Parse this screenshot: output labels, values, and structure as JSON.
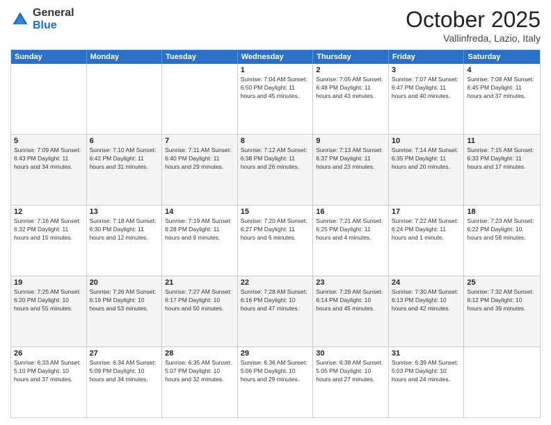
{
  "logo": {
    "general": "General",
    "blue": "Blue"
  },
  "header": {
    "month": "October 2025",
    "location": "Vallinfreda, Lazio, Italy"
  },
  "days": [
    "Sunday",
    "Monday",
    "Tuesday",
    "Wednesday",
    "Thursday",
    "Friday",
    "Saturday"
  ],
  "weeks": [
    [
      {
        "day": "",
        "info": ""
      },
      {
        "day": "",
        "info": ""
      },
      {
        "day": "",
        "info": ""
      },
      {
        "day": "1",
        "info": "Sunrise: 7:04 AM\nSunset: 6:50 PM\nDaylight: 11 hours and 45 minutes."
      },
      {
        "day": "2",
        "info": "Sunrise: 7:05 AM\nSunset: 6:48 PM\nDaylight: 11 hours and 43 minutes."
      },
      {
        "day": "3",
        "info": "Sunrise: 7:07 AM\nSunset: 6:47 PM\nDaylight: 11 hours and 40 minutes."
      },
      {
        "day": "4",
        "info": "Sunrise: 7:08 AM\nSunset: 6:45 PM\nDaylight: 11 hours and 37 minutes."
      }
    ],
    [
      {
        "day": "5",
        "info": "Sunrise: 7:09 AM\nSunset: 6:43 PM\nDaylight: 11 hours and 34 minutes."
      },
      {
        "day": "6",
        "info": "Sunrise: 7:10 AM\nSunset: 6:42 PM\nDaylight: 11 hours and 31 minutes."
      },
      {
        "day": "7",
        "info": "Sunrise: 7:11 AM\nSunset: 6:40 PM\nDaylight: 11 hours and 29 minutes."
      },
      {
        "day": "8",
        "info": "Sunrise: 7:12 AM\nSunset: 6:38 PM\nDaylight: 11 hours and 26 minutes."
      },
      {
        "day": "9",
        "info": "Sunrise: 7:13 AM\nSunset: 6:37 PM\nDaylight: 11 hours and 23 minutes."
      },
      {
        "day": "10",
        "info": "Sunrise: 7:14 AM\nSunset: 6:35 PM\nDaylight: 11 hours and 20 minutes."
      },
      {
        "day": "11",
        "info": "Sunrise: 7:15 AM\nSunset: 6:33 PM\nDaylight: 11 hours and 17 minutes."
      }
    ],
    [
      {
        "day": "12",
        "info": "Sunrise: 7:16 AM\nSunset: 6:32 PM\nDaylight: 11 hours and 15 minutes."
      },
      {
        "day": "13",
        "info": "Sunrise: 7:18 AM\nSunset: 6:30 PM\nDaylight: 11 hours and 12 minutes."
      },
      {
        "day": "14",
        "info": "Sunrise: 7:19 AM\nSunset: 6:28 PM\nDaylight: 11 hours and 9 minutes."
      },
      {
        "day": "15",
        "info": "Sunrise: 7:20 AM\nSunset: 6:27 PM\nDaylight: 11 hours and 6 minutes."
      },
      {
        "day": "16",
        "info": "Sunrise: 7:21 AM\nSunset: 6:25 PM\nDaylight: 11 hours and 4 minutes."
      },
      {
        "day": "17",
        "info": "Sunrise: 7:22 AM\nSunset: 6:24 PM\nDaylight: 11 hours and 1 minute."
      },
      {
        "day": "18",
        "info": "Sunrise: 7:23 AM\nSunset: 6:22 PM\nDaylight: 10 hours and 58 minutes."
      }
    ],
    [
      {
        "day": "19",
        "info": "Sunrise: 7:25 AM\nSunset: 6:20 PM\nDaylight: 10 hours and 55 minutes."
      },
      {
        "day": "20",
        "info": "Sunrise: 7:26 AM\nSunset: 6:19 PM\nDaylight: 10 hours and 53 minutes."
      },
      {
        "day": "21",
        "info": "Sunrise: 7:27 AM\nSunset: 6:17 PM\nDaylight: 10 hours and 50 minutes."
      },
      {
        "day": "22",
        "info": "Sunrise: 7:28 AM\nSunset: 6:16 PM\nDaylight: 10 hours and 47 minutes."
      },
      {
        "day": "23",
        "info": "Sunrise: 7:29 AM\nSunset: 6:14 PM\nDaylight: 10 hours and 45 minutes."
      },
      {
        "day": "24",
        "info": "Sunrise: 7:30 AM\nSunset: 6:13 PM\nDaylight: 10 hours and 42 minutes."
      },
      {
        "day": "25",
        "info": "Sunrise: 7:32 AM\nSunset: 6:12 PM\nDaylight: 10 hours and 39 minutes."
      }
    ],
    [
      {
        "day": "26",
        "info": "Sunrise: 6:33 AM\nSunset: 5:10 PM\nDaylight: 10 hours and 37 minutes."
      },
      {
        "day": "27",
        "info": "Sunrise: 6:34 AM\nSunset: 5:09 PM\nDaylight: 10 hours and 34 minutes."
      },
      {
        "day": "28",
        "info": "Sunrise: 6:35 AM\nSunset: 5:07 PM\nDaylight: 10 hours and 32 minutes."
      },
      {
        "day": "29",
        "info": "Sunrise: 6:36 AM\nSunset: 5:06 PM\nDaylight: 10 hours and 29 minutes."
      },
      {
        "day": "30",
        "info": "Sunrise: 6:38 AM\nSunset: 5:05 PM\nDaylight: 10 hours and 27 minutes."
      },
      {
        "day": "31",
        "info": "Sunrise: 6:39 AM\nSunset: 5:03 PM\nDaylight: 10 hours and 24 minutes."
      },
      {
        "day": "",
        "info": ""
      }
    ]
  ]
}
